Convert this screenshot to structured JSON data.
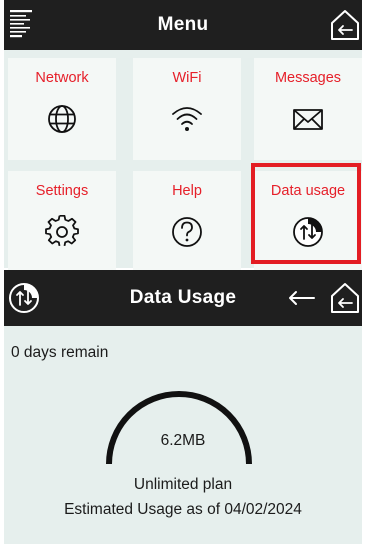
{
  "menu": {
    "title": "Menu",
    "left_icon": "hamburger-menu-icon",
    "right_icon": "home-icon",
    "tiles": [
      {
        "label": "Network",
        "icon": "globe-icon"
      },
      {
        "label": "WiFi",
        "icon": "wifi-icon"
      },
      {
        "label": "Messages",
        "icon": "envelope-icon"
      },
      {
        "label": "Settings",
        "icon": "gear-icon"
      },
      {
        "label": "Help",
        "icon": "question-icon"
      },
      {
        "label": "Data usage",
        "icon": "data-usage-icon",
        "selected": true
      }
    ]
  },
  "usage_screen": {
    "title": "Data Usage",
    "left_icon": "data-usage-icon",
    "back_icon": "back-arrow-icon",
    "home_icon": "home-icon",
    "days_remaining": "0 days remain",
    "amount_used": "6.2MB",
    "plan": "Unlimited plan",
    "estimate": "Estimated Usage as of 04/02/2024"
  },
  "colors": {
    "header_bg": "#1f1f1f",
    "panel_bg": "#e6efed",
    "tile_bg": "#f4f8f6",
    "label_red": "#e6202a",
    "highlight_red": "#e31d23"
  }
}
